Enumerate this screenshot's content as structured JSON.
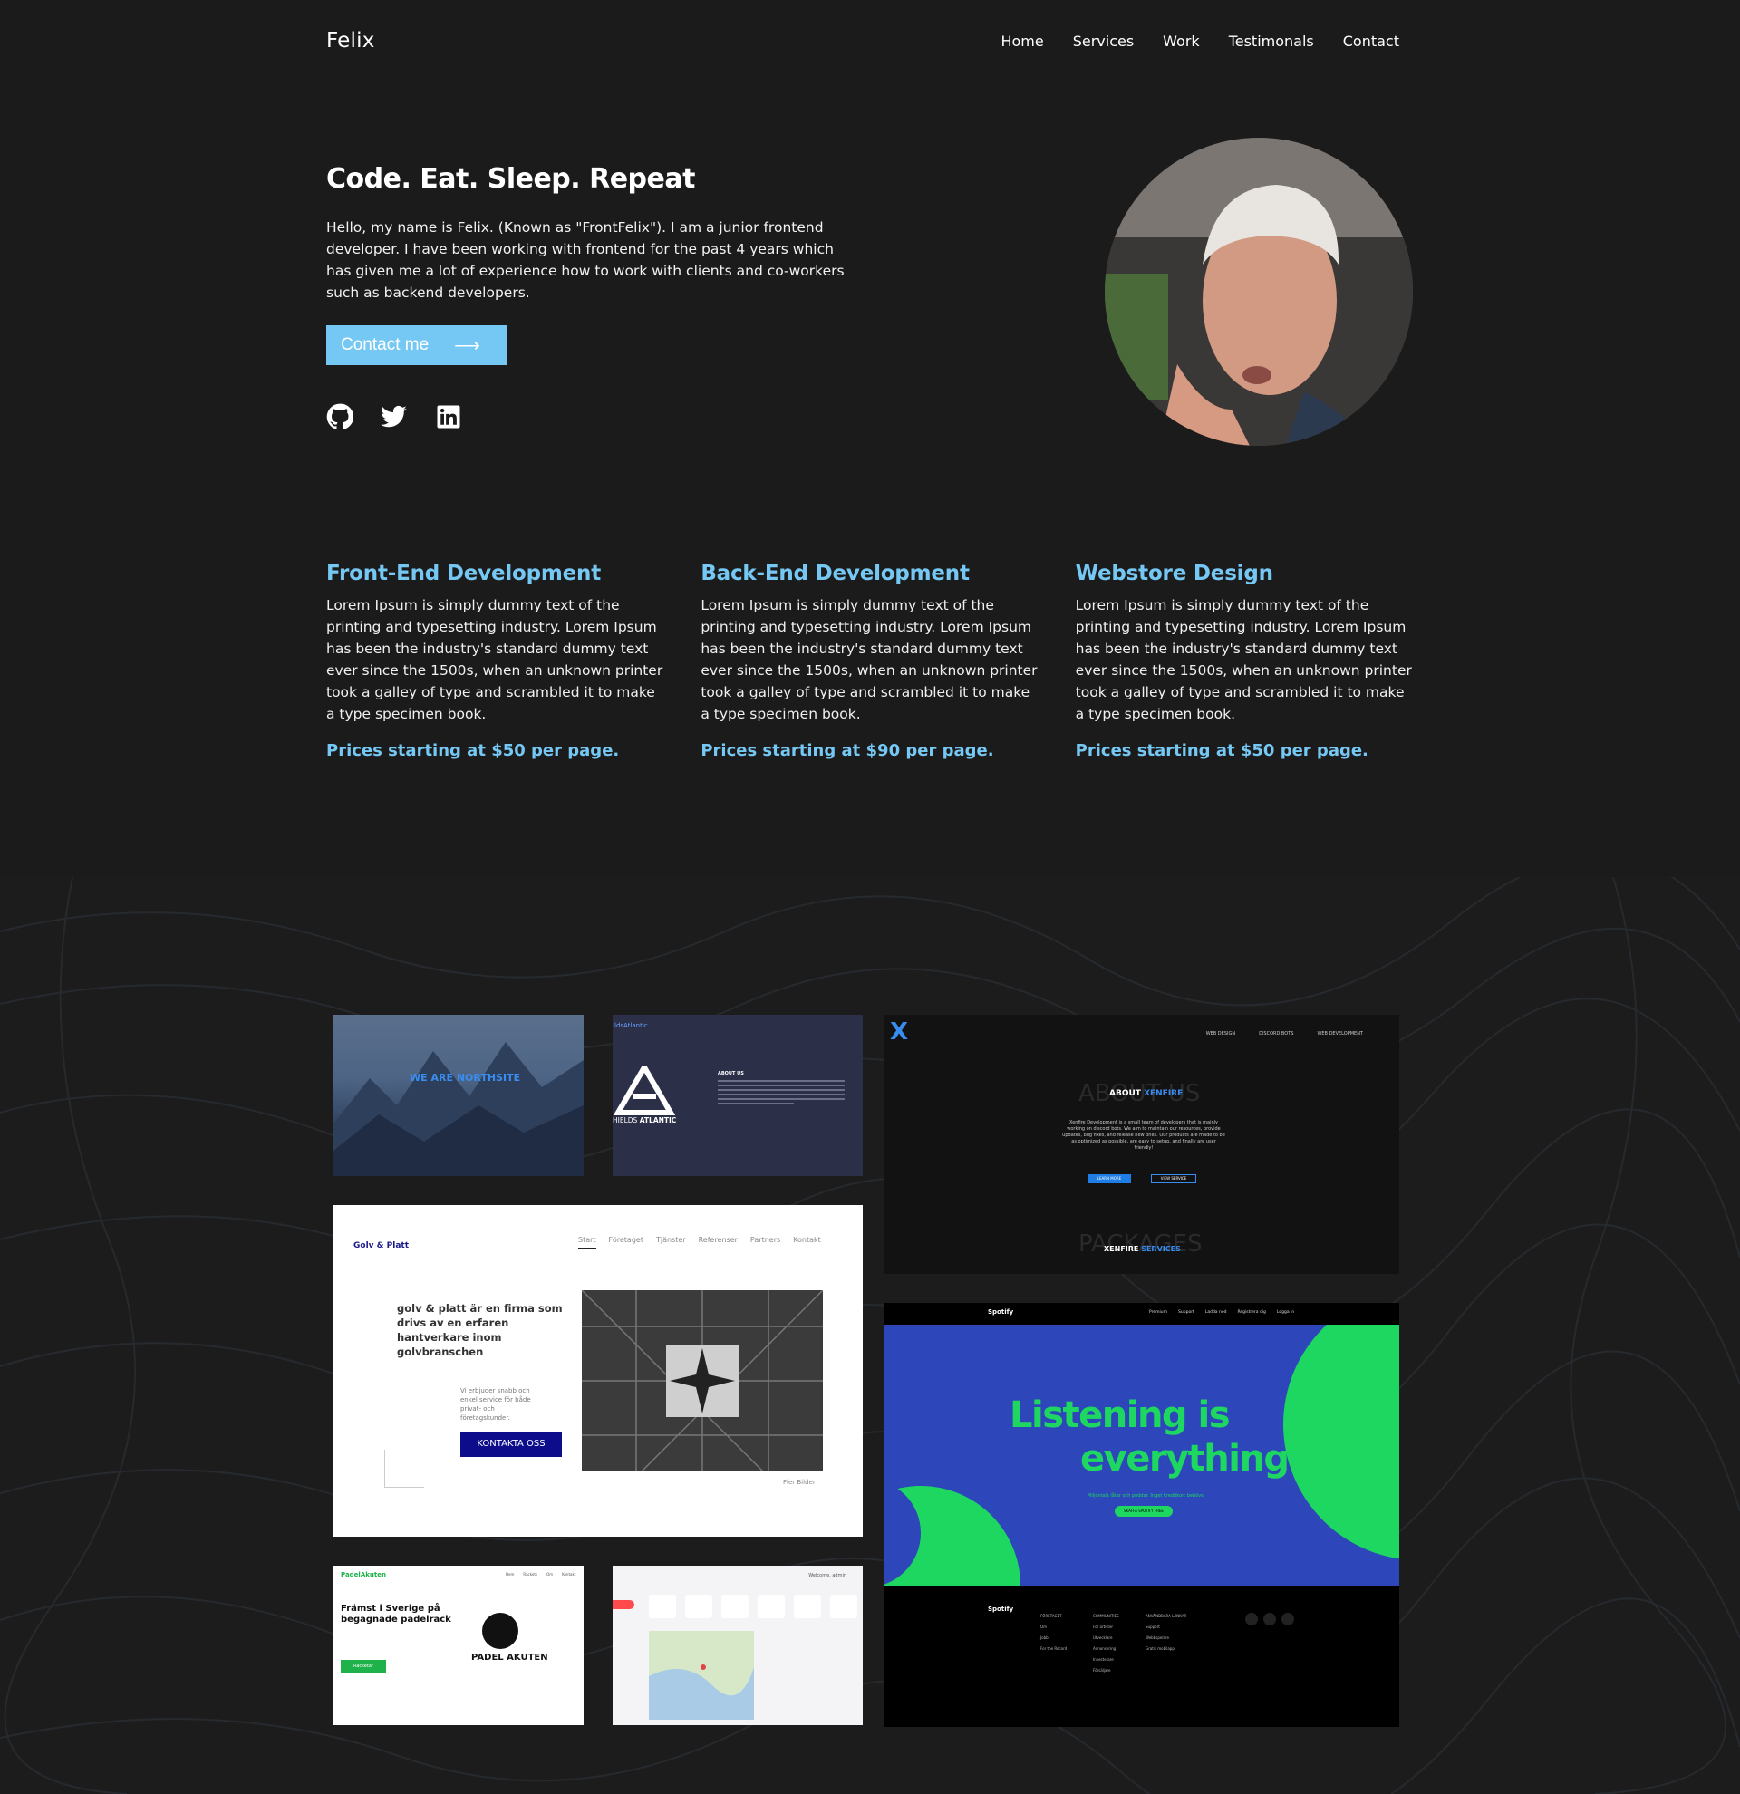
{
  "nav": {
    "brand": "Felix",
    "links": [
      "Home",
      "Services",
      "Work",
      "Testimonals",
      "Contact"
    ]
  },
  "hero": {
    "title": "Code. Eat. Sleep. Repeat",
    "intro": "Hello, my name is Felix. (Known as \"FrontFelix\"). I am a junior frontend developer. I have been working with frontend for the past 4 years which has given me a lot of experience how to work with clients and co-workers such as backend developers.",
    "cta_label": "Contact me",
    "cta_arrow": "⟶",
    "socials": [
      "github-icon",
      "twitter-icon",
      "linkedin-icon"
    ]
  },
  "services": [
    {
      "title": "Front-End Development",
      "body": "Lorem Ipsum is simply dummy text of the printing and typesetting industry. Lorem Ipsum has been the industry's standard dummy text ever since the 1500s, when an unknown printer took a galley of type and scrambled it to make a type specimen book.",
      "price": "Prices starting at $50 per page."
    },
    {
      "title": "Back-End Development",
      "body": "Lorem Ipsum is simply dummy text of the printing and typesetting industry. Lorem Ipsum has been the industry's standard dummy text ever since the 1500s, when an unknown printer took a galley of type and scrambled it to make a type specimen book.",
      "price": "Prices starting at $90 per page."
    },
    {
      "title": "Webstore Design",
      "body": "Lorem Ipsum is simply dummy text of the printing and typesetting industry. Lorem Ipsum has been the industry's standard dummy text ever since the 1500s, when an unknown printer took a galley of type and scrambled it to make a type specimen book.",
      "price": "Prices starting at $50 per page."
    }
  ],
  "work": {
    "northsite": {
      "title_pre": "WE ARE ",
      "title_accent": "NORTHSITE"
    },
    "shields": {
      "brand": "ldsAtlantic",
      "name_pre": "HIELDS ",
      "name_accent": "ATLANTIC",
      "about": "ABOUT US"
    },
    "xenfire": {
      "logo": "X",
      "menu": [
        "WEB DESIGN",
        "DISCORD BOTS",
        "WEB DEVELOPMENT"
      ],
      "ghost_about": "ABOUT US",
      "about_pre": "ABOUT ",
      "about_accent": "XENFIRE",
      "desc": "Xenfire Development is a small team of developers that is mainly working on discord bots. We aim to maintain our resources, provide updates, bug fixes, and release new ones. Our products are made to be as optimized as possible, are easy to setup, and finally are user friendly!",
      "btn_learn": "LEARN MORE",
      "btn_view": "VIEW SERVICE",
      "ghost_services": "PACKAGES",
      "services_pre": "XENFIRE ",
      "services_accent": "SERVICES"
    },
    "golv": {
      "logo": "Golv & Platt",
      "menu": [
        "Start",
        "Företaget",
        "Tjänster",
        "Referenser",
        "Partners",
        "Kontakt"
      ],
      "headline": "golv & platt är en firma som drivs av en erfaren hantverkare inom golvbranschen",
      "sub": "Vi erbjuder snabb och enkel service för både privat- och företagskunder.",
      "cta": "KONTAKTA OSS",
      "more": "Fler Bilder"
    },
    "spotify": {
      "logo": "Spotify",
      "menu": [
        "Premium",
        "Support",
        "Ladda ned",
        "Registrera dig",
        "Logga in"
      ],
      "headline_1": "Listening is",
      "headline_2": "everything",
      "tagline": "Miljontals låtar och poddar. Inget kreditkort behövs.",
      "cta": "SKAFFA SPOTIFY FREE",
      "footer_cols": [
        [
          "FÖRETAGET",
          "Om",
          "Jobb",
          "For the Record"
        ],
        [
          "COMMUNITIES",
          "För artister",
          "Utvecklare",
          "Annonsering",
          "Investerare",
          "Försäljare"
        ],
        [
          "ANVÄNDBARA LÄNKAR",
          "Support",
          "Webbspelare",
          "Gratis mobilapp"
        ]
      ]
    },
    "padel": {
      "logo": "PadelAkuten",
      "menu": [
        "Hem",
        "Rackets",
        "Om",
        "Kontakt"
      ],
      "headline": "Främst i Sverige på begagnade padelrack",
      "cta": "Racketar",
      "brand": "PADEL AKUTEN"
    },
    "dashboard": {
      "greeting": "Welcome, admin"
    }
  },
  "colors": {
    "background": "#1b1b1b",
    "accent": "#76c8f4",
    "text": "#ffffff"
  }
}
